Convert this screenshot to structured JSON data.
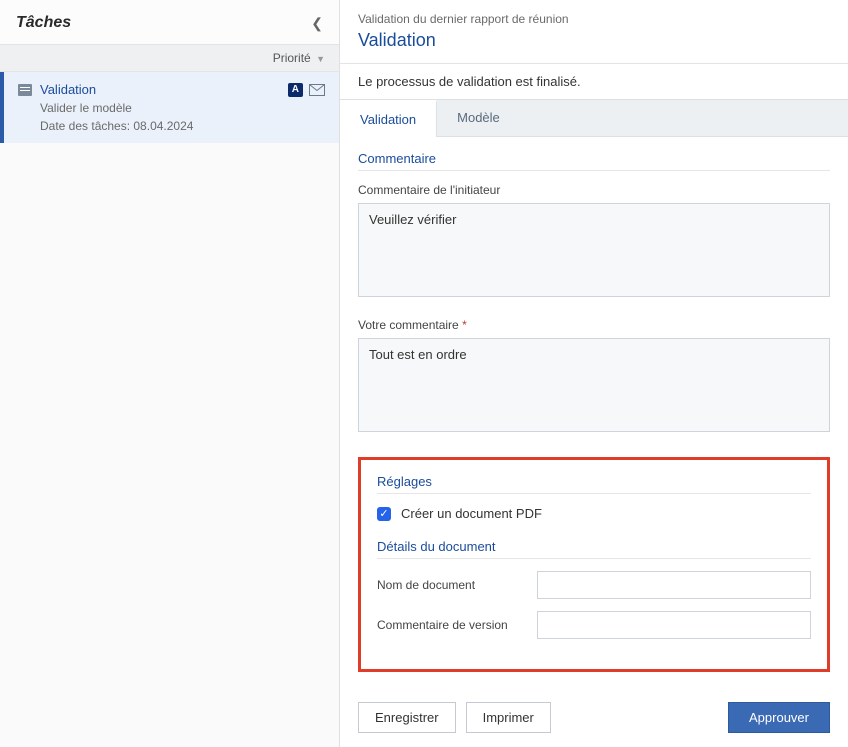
{
  "left": {
    "title": "Tâches",
    "priority_label": "Priorité",
    "task": {
      "name": "Validation",
      "badge": "A",
      "subtitle": "Valider le modèle",
      "date_label": "Date des tâches: 08.04.2024"
    }
  },
  "right": {
    "breadcrumb": "Validation du dernier rapport de réunion",
    "title": "Validation",
    "status": "Le processus de validation est finalisé.",
    "tabs": {
      "validation": "Validation",
      "modele": "Modèle"
    },
    "section_comment": "Commentaire",
    "initiator_label": "Commentaire de l'initiateur",
    "initiator_value": "Veuillez vérifier",
    "your_comment_label": "Votre commentaire",
    "your_comment_value": "Tout est en ordre",
    "section_settings": "Réglages",
    "create_pdf_label": "Créer un document PDF",
    "create_pdf_checked": true,
    "section_doc": "Détails du document",
    "doc_name_label": "Nom de document",
    "doc_name_value": "",
    "version_comment_label": "Commentaire de version",
    "version_comment_value": "",
    "buttons": {
      "save": "Enregistrer",
      "print": "Imprimer",
      "approve": "Approuver"
    }
  }
}
